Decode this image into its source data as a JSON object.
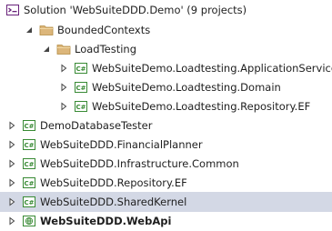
{
  "solution_explorer": {
    "solution": {
      "label": "Solution 'WebSuiteDDD.Demo' (9 projects)",
      "icon": "solution-icon"
    },
    "nodes": [
      {
        "label": "BoundedContexts",
        "icon": "folder-icon",
        "expander": "expanded",
        "depth": 1,
        "bold": false,
        "selected": false
      },
      {
        "label": "LoadTesting",
        "icon": "folder-icon",
        "expander": "expanded",
        "depth": 2,
        "bold": false,
        "selected": false
      },
      {
        "label": "WebSuiteDemo.Loadtesting.ApplicationServices",
        "icon": "csharp-project-icon",
        "expander": "collapsed",
        "depth": 3,
        "bold": false,
        "selected": false
      },
      {
        "label": "WebSuiteDemo.Loadtesting.Domain",
        "icon": "csharp-project-icon",
        "expander": "collapsed",
        "depth": 3,
        "bold": false,
        "selected": false
      },
      {
        "label": "WebSuiteDemo.Loadtesting.Repository.EF",
        "icon": "csharp-project-icon",
        "expander": "collapsed",
        "depth": 3,
        "bold": false,
        "selected": false
      },
      {
        "label": "DemoDatabaseTester",
        "icon": "csharp-project-icon",
        "expander": "collapsed",
        "depth": 0,
        "bold": false,
        "selected": false
      },
      {
        "label": "WebSuiteDDD.FinancialPlanner",
        "icon": "csharp-project-icon",
        "expander": "collapsed",
        "depth": 0,
        "bold": false,
        "selected": false
      },
      {
        "label": "WebSuiteDDD.Infrastructure.Common",
        "icon": "csharp-project-icon",
        "expander": "collapsed",
        "depth": 0,
        "bold": false,
        "selected": false
      },
      {
        "label": "WebSuiteDDD.Repository.EF",
        "icon": "csharp-project-icon",
        "expander": "collapsed",
        "depth": 0,
        "bold": false,
        "selected": false
      },
      {
        "label": "WebSuiteDDD.SharedKernel",
        "icon": "csharp-project-icon",
        "expander": "collapsed",
        "depth": 0,
        "bold": false,
        "selected": true
      },
      {
        "label": "WebSuiteDDD.WebApi",
        "icon": "web-project-icon",
        "expander": "collapsed",
        "depth": 0,
        "bold": true,
        "selected": false
      }
    ]
  },
  "colors": {
    "selection_background": "#d3d8e5",
    "folder": "#dcb67a",
    "csharp_project": "#388a34",
    "web_project": "#388a34",
    "solution": "#68217a",
    "text": "#1e1e1e"
  }
}
